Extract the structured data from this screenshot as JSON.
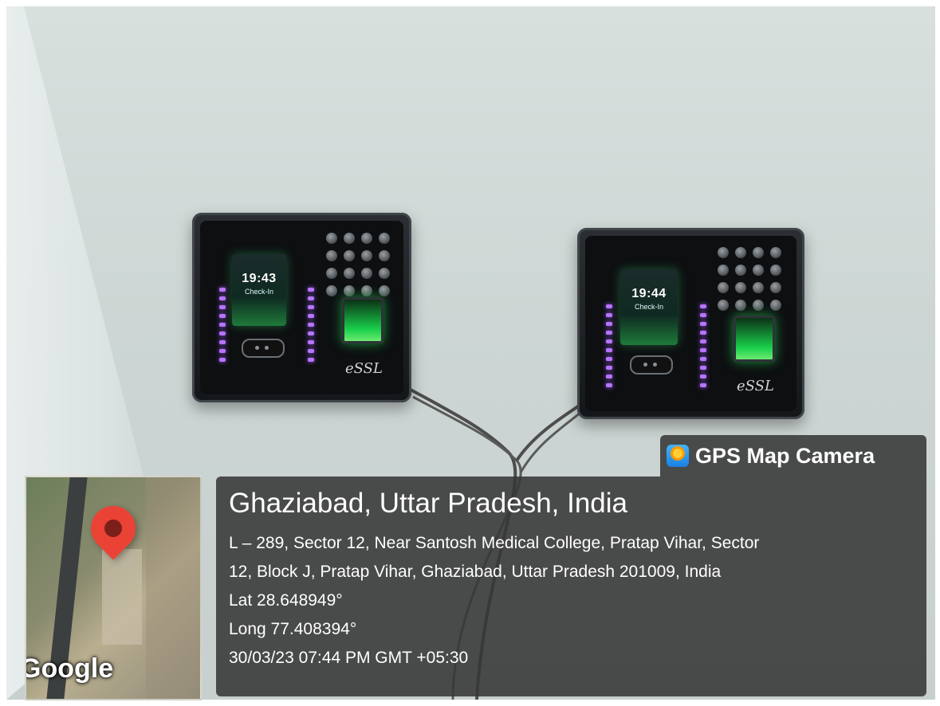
{
  "devices": [
    {
      "time": "19:43",
      "status": "Check-In",
      "brand": "eSSL"
    },
    {
      "time": "19:44",
      "status": "Check-In",
      "brand": "eSSL"
    }
  ],
  "overlay": {
    "app_name": "GPS Map Camera",
    "location_title": "Ghaziabad, Uttar Pradesh, India",
    "address_line1": "L – 289, Sector 12, Near Santosh Medical College, Pratap Vihar, Sector",
    "address_line2": "12, Block J, Pratap Vihar, Ghaziabad, Uttar Pradesh 201009, India",
    "lat": "Lat 28.648949°",
    "long": "Long 77.408394°",
    "timestamp": "30/03/23 07:44 PM GMT +05:30"
  },
  "map": {
    "brand": "Google",
    "pin_icon": "map-pin-icon"
  },
  "colors": {
    "overlay_bg": "#373737",
    "pin": "#ea4335",
    "screen_glow": "#1ad04b",
    "led": "#b774ff"
  }
}
